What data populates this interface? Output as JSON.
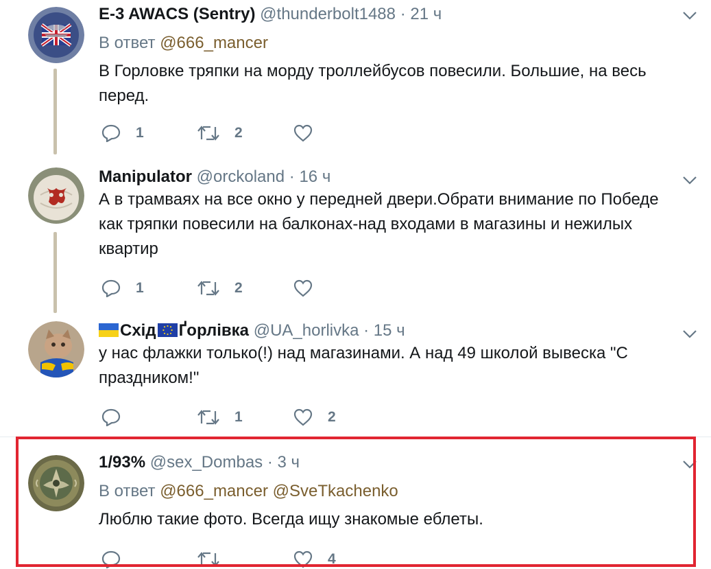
{
  "tweets": [
    {
      "name": "E-3 AWACS (Sentry)",
      "handle": "@thunderbolt1488",
      "time": "21 ч",
      "reply_prefix": "В ответ",
      "reply_mentions": [
        "@666_mancer"
      ],
      "text": "В Горловке тряпки на морду троллейбусов повесили. Большие, на весь перед.",
      "replies": "1",
      "retweets": "2",
      "likes": ""
    },
    {
      "name": "Manipulator",
      "handle": "@orckoland",
      "time": "16 ч",
      "text": "А в трамваях на все окно у передней двери.Обрати внимание по Победе как тряпки повесили на балконах-над входами в магазины и нежилых квартир",
      "replies": "1",
      "retweets": "2",
      "likes": ""
    },
    {
      "name_part1": "Схід",
      "name_part2": "Ґорлівка",
      "handle": "@UA_horlivka",
      "time": "15 ч",
      "text": "у нас флажки только(!) над магазинами. А над 49 школой вывеска \"С праздником!\"",
      "replies": "",
      "retweets": "1",
      "likes": "2"
    },
    {
      "name": "1/93%",
      "handle": "@sex_Dombas",
      "time": "3 ч",
      "reply_prefix": "В ответ",
      "reply_mentions": [
        "@666_mancer",
        "@SveTkachenko"
      ],
      "text": "Люблю такие фото. Всегда ищу знакомые еблеты.",
      "replies": "",
      "retweets": "",
      "likes": "4"
    }
  ],
  "separator_dot": "·",
  "colors": {
    "highlight_border": "#e12531",
    "thread_line": "#c9c1ac",
    "mention": "#7a5e2e",
    "secondary_text": "#657786"
  },
  "icons": [
    "reply-icon",
    "retweet-icon",
    "like-icon",
    "caret-down-icon",
    "flag-ukraine-icon",
    "flag-eu-icon"
  ]
}
